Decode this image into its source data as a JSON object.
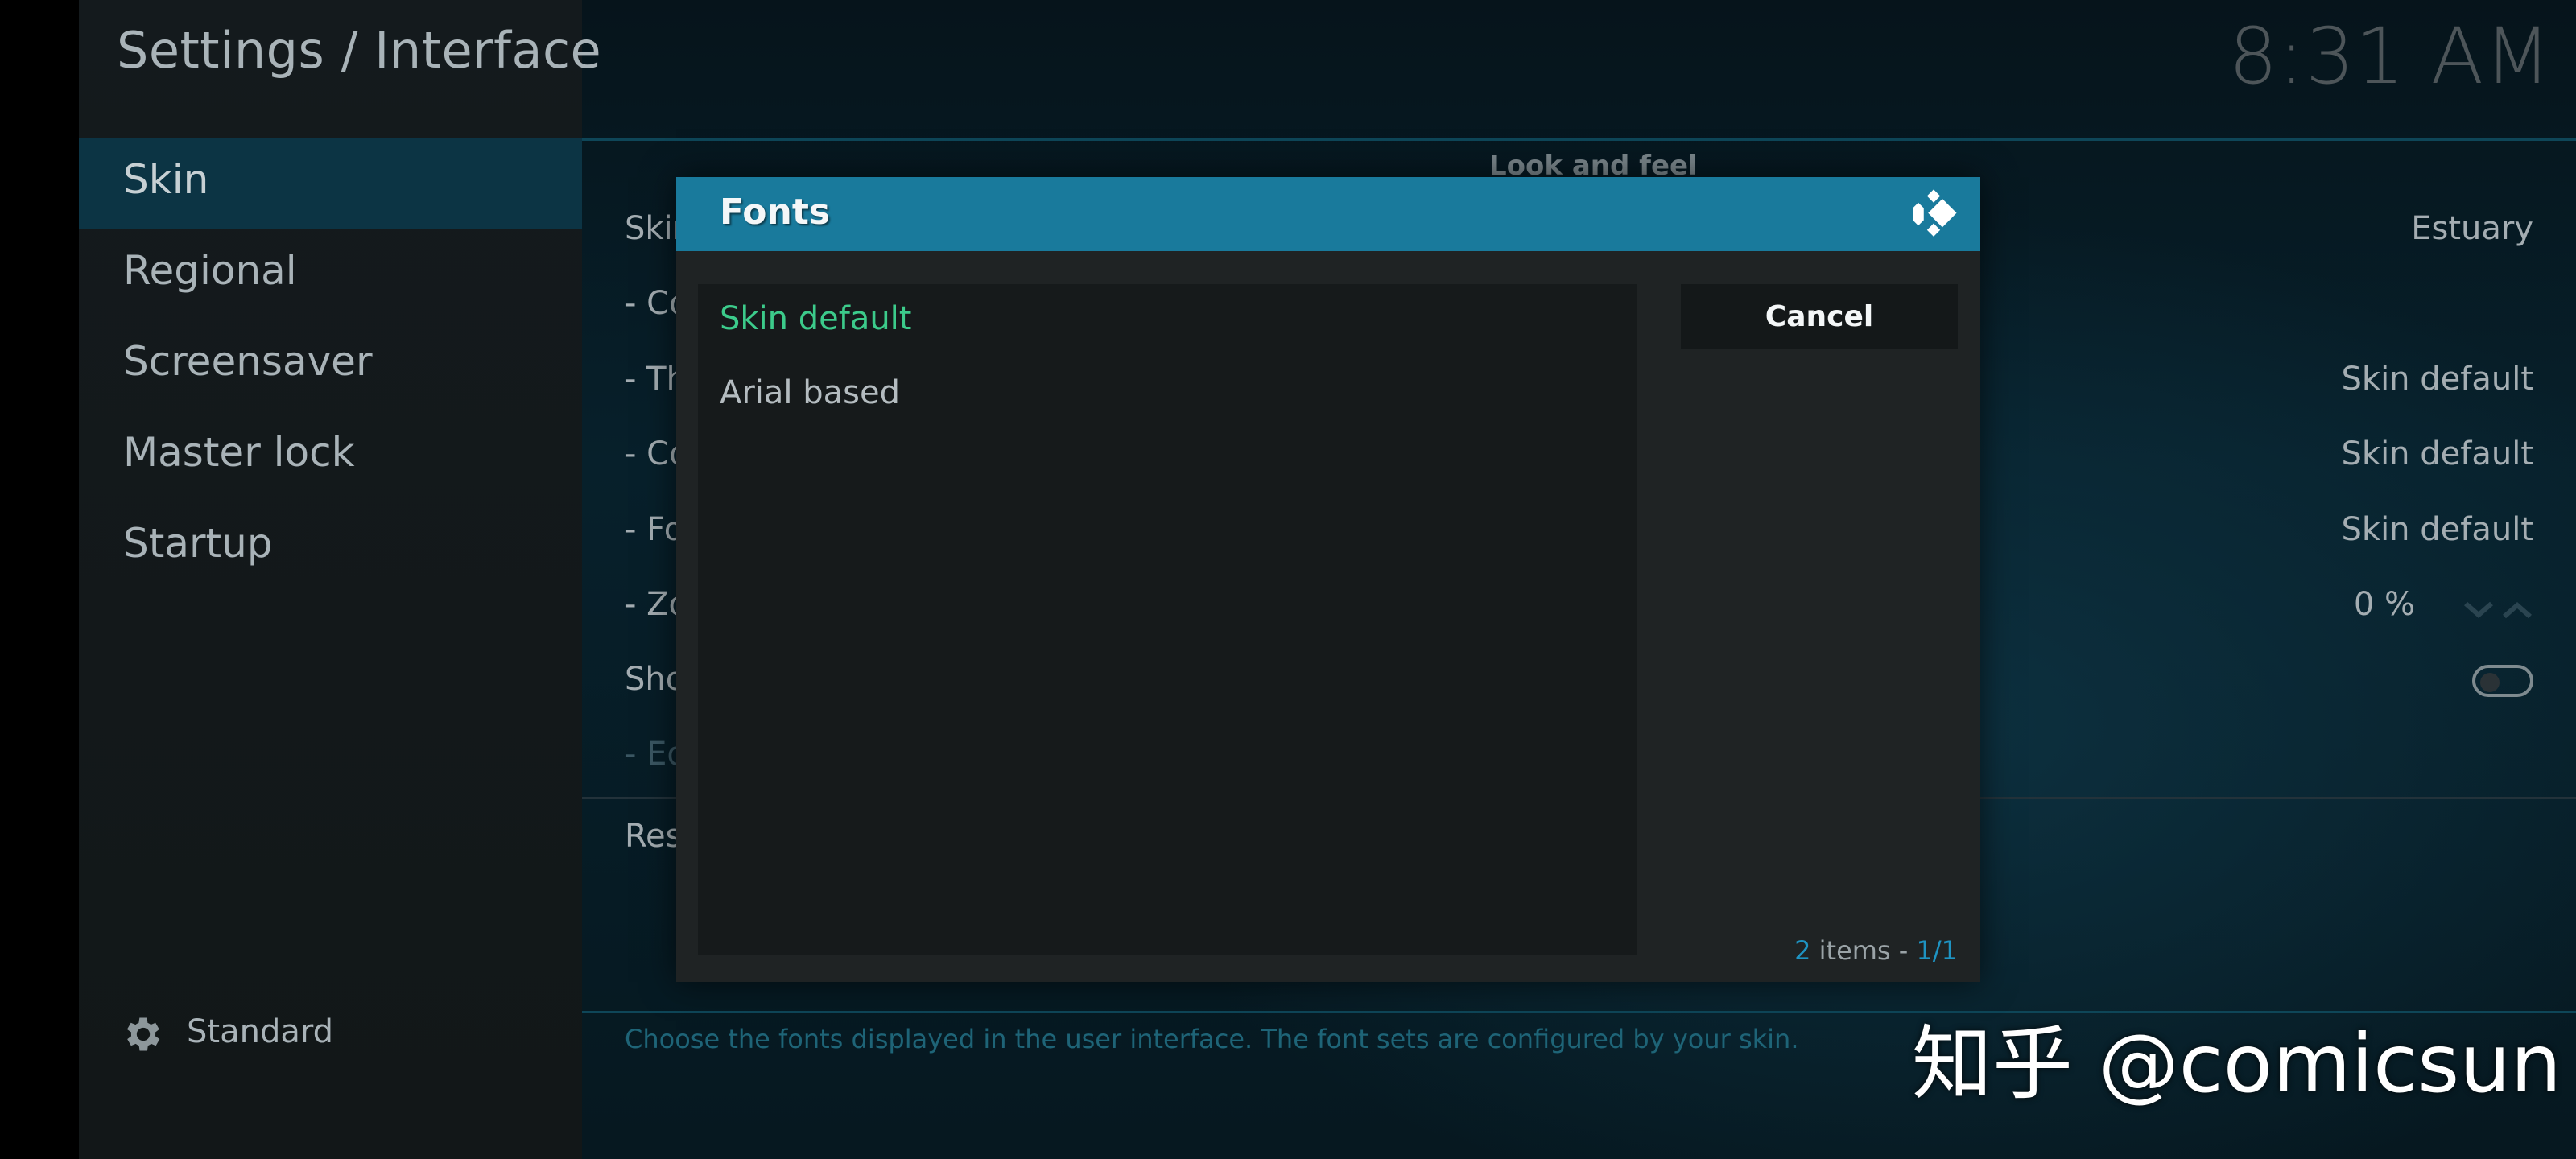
{
  "window": {
    "title": "Settings / Interface",
    "clock": "8:31 AM"
  },
  "sidebar": {
    "items": [
      {
        "label": "Skin",
        "active": true
      },
      {
        "label": "Regional"
      },
      {
        "label": "Screensaver"
      },
      {
        "label": "Master lock"
      },
      {
        "label": "Startup"
      }
    ],
    "profile": {
      "icon": "gear-icon",
      "label": "Standard"
    }
  },
  "settings": {
    "section_header": "Look and feel",
    "rows": [
      {
        "label": "Skin",
        "value": "Estuary"
      },
      {
        "label": "- Co",
        "value": ""
      },
      {
        "label": "- Th",
        "value": "Skin default"
      },
      {
        "label": "- Co",
        "value": "Skin default"
      },
      {
        "label": "- Fo",
        "value": "Skin default"
      },
      {
        "label": "- Zo",
        "value": "0 %"
      },
      {
        "label": "Sho",
        "value": ""
      },
      {
        "label": "- Ed",
        "value": ""
      },
      {
        "label": "Res",
        "value": ""
      }
    ],
    "description": "Choose the fonts displayed in the user interface. The font sets are configured by your skin."
  },
  "dialog": {
    "title": "Fonts",
    "logo_icon": "kodi-logo-icon",
    "items": [
      {
        "label": "Skin default",
        "selected": true
      },
      {
        "label": "Arial based",
        "selected": false
      }
    ],
    "cancel_label": "Cancel",
    "count": {
      "num": "2",
      "items_text": " items - ",
      "page": "1/1"
    }
  },
  "watermark": "知乎 @comicsun",
  "colors": {
    "accent": "#197a9c",
    "selected_text": "#3ccb8b",
    "sidebar_active": "#0c3444",
    "count_highlight": "#1e93c2"
  }
}
